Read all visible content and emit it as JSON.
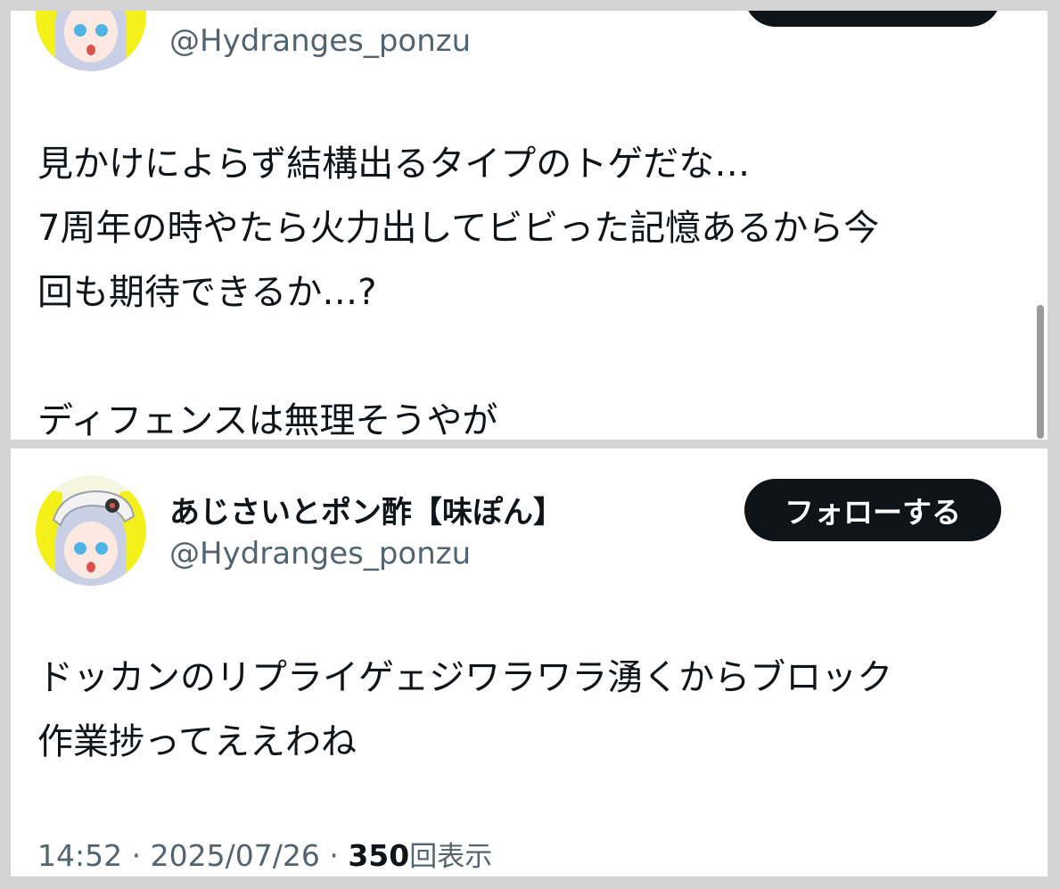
{
  "top_tweet": {
    "handle": "@Hydranges_ponzu",
    "text_lines": [
      "見かけによらず結構出るタイプのトゲだな…",
      "7周年の時やたら火力出してビビった記憶あるから今",
      "回も期待できるか…?",
      "",
      "ディフェンスは無理そうやが"
    ]
  },
  "bottom_tweet": {
    "display_name": "あじさいとポン酢【味ぽん】",
    "handle": "@Hydranges_ponzu",
    "follow_label": "フォローする",
    "text_lines": [
      "ドッカンのリプライゲェジワラワラ湧くからブロック",
      "作業捗ってええわね"
    ],
    "time": "14:52",
    "separator": "·",
    "date": "2025/07/26",
    "views_count": "350",
    "views_label": "回表示"
  },
  "colors": {
    "text_primary": "#0f1419",
    "text_secondary": "#536471",
    "button_bg": "#0f1419",
    "divider": "#d4d4d4"
  },
  "icons": [
    "user-avatar-icon"
  ]
}
